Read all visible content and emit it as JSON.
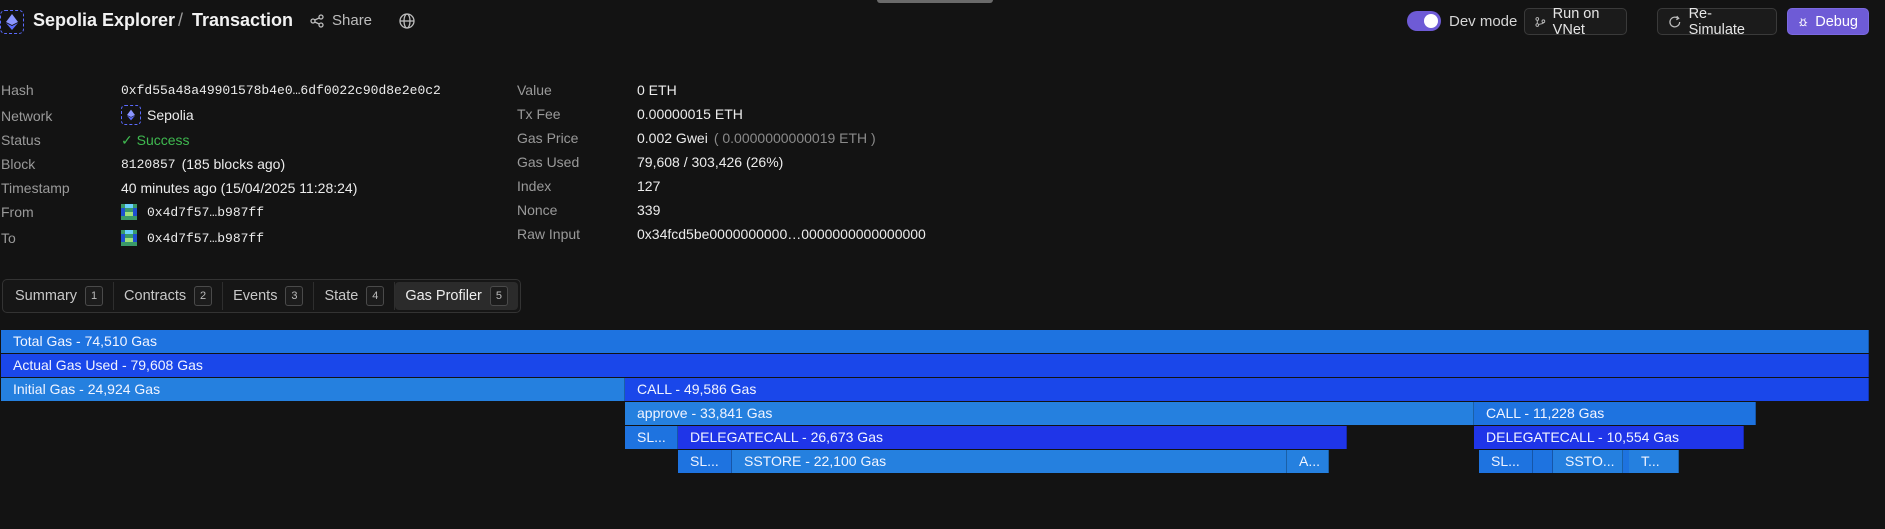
{
  "header": {
    "app_title": "Sepolia Explorer",
    "separator": "/",
    "page_title": "Transaction",
    "share_label": "Share",
    "dev_mode_label": "Dev mode",
    "dev_mode_on": true,
    "run_on_vnet_label": "Run on VNet",
    "resimulate_label": "Re-Simulate",
    "debug_label": "Debug"
  },
  "details_left": {
    "hash_label": "Hash",
    "hash_value": "0xfd55a48a49901578b4e0…6df0022c90d8e2e0c2",
    "network_label": "Network",
    "network_value": "Sepolia",
    "status_label": "Status",
    "status_value": "✓ Success",
    "block_label": "Block",
    "block_number": "8120857",
    "block_ago": "(185 blocks ago)",
    "timestamp_label": "Timestamp",
    "timestamp_value": "40 minutes ago (15/04/2025 11:28:24)",
    "from_label": "From",
    "from_value": "0x4d7f57…b987ff",
    "to_label": "To",
    "to_value": "0x4d7f57…b987ff"
  },
  "details_right": {
    "value_label": "Value",
    "value_value": "0 ETH",
    "txfee_label": "Tx Fee",
    "txfee_value": "0.00000015 ETH",
    "gasprice_label": "Gas Price",
    "gasprice_value": "0.002 Gwei",
    "gasprice_eth": "( 0.0000000000019 ETH )",
    "gasused_label": "Gas Used",
    "gasused_value": "79,608 / 303,426 (26%)",
    "index_label": "Index",
    "index_value": "127",
    "nonce_label": "Nonce",
    "nonce_value": "339",
    "rawinput_label": "Raw Input",
    "rawinput_value": "0x34fcd5be0000000000…0000000000000000"
  },
  "tabs": [
    {
      "label": "Summary",
      "key": "1"
    },
    {
      "label": "Contracts",
      "key": "2"
    },
    {
      "label": "Events",
      "key": "3"
    },
    {
      "label": "State",
      "key": "4"
    },
    {
      "label": "Gas Profiler",
      "key": "5",
      "active": true
    }
  ],
  "flame": {
    "total": "Total Gas - 74,510 Gas",
    "actual": "Actual Gas Used - 79,608 Gas",
    "initial": "Initial Gas - 24,924 Gas",
    "call1": "CALL - 49,586 Gas",
    "approve": "approve - 33,841 Gas",
    "call2": "CALL - 11,228 Gas",
    "sl1": "SL...",
    "delegatecall1": "DELEGATECALL - 26,673 Gas",
    "delegatecall2": "DELEGATECALL - 10,554 Gas",
    "sl2": "SL...",
    "sstore1": "SSTORE - 22,100 Gas",
    "a1": "A...",
    "sl3": "SL...",
    "ssto": "SSTO...",
    "t1": "T..."
  }
}
